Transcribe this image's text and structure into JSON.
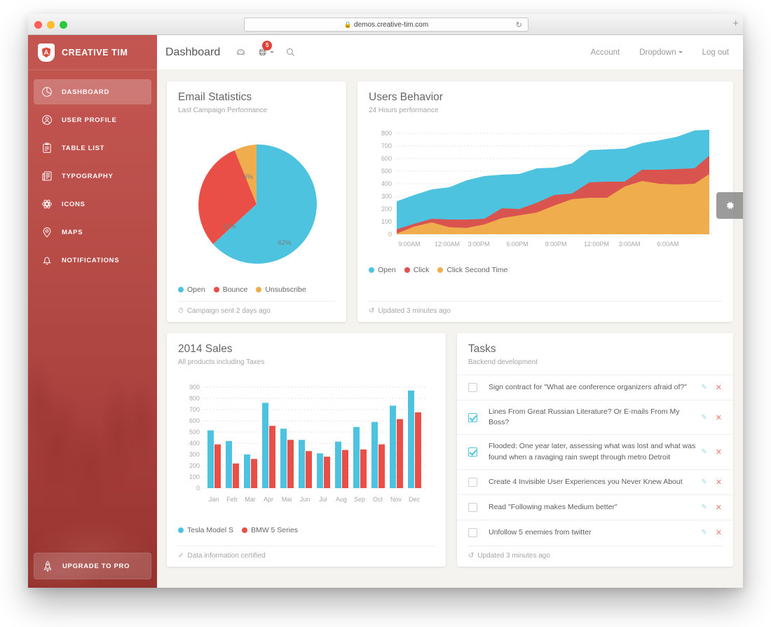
{
  "browser": {
    "url": "demos.creative-tim.com",
    "lock_icon": "lock-icon",
    "reload_icon": "reload-icon",
    "new_tab_label": "+"
  },
  "sidebar": {
    "brand": "CREATIVE TIM",
    "logo_icon": "angular-shield-icon",
    "items": [
      {
        "label": "DASHBOARD",
        "icon": "pie-chart-icon",
        "active": true
      },
      {
        "label": "USER PROFILE",
        "icon": "user-circle-icon",
        "active": false
      },
      {
        "label": "TABLE LIST",
        "icon": "clipboard-icon",
        "active": false
      },
      {
        "label": "TYPOGRAPHY",
        "icon": "document-icon",
        "active": false
      },
      {
        "label": "ICONS",
        "icon": "atom-icon",
        "active": false
      },
      {
        "label": "MAPS",
        "icon": "map-pin-icon",
        "active": false
      },
      {
        "label": "NOTIFICATIONS",
        "icon": "bell-icon",
        "active": false
      }
    ],
    "upgrade": {
      "label": "UPGRADE TO PRO",
      "icon": "rocket-icon"
    }
  },
  "topnav": {
    "title": "Dashboard",
    "dashboard_icon": "dashboard-gauge-icon",
    "globe_icon": "globe-icon",
    "notification_count": "5",
    "search_icon": "search-icon",
    "links": [
      {
        "label": "Account",
        "caret": false
      },
      {
        "label": "Dropdown",
        "caret": true
      },
      {
        "label": "Log out",
        "caret": false
      }
    ]
  },
  "gear_tab": {
    "icon": "gear-icon"
  },
  "cards": {
    "email_statistics": {
      "title": "Email Statistics",
      "subtitle": "Last Campaign Performance",
      "footer": "Campaign sent 2 days ago",
      "footer_icon": "clock-icon"
    },
    "users_behavior": {
      "title": "Users Behavior",
      "subtitle": "24 Hours performance",
      "footer": "Updated 3 minutes ago",
      "footer_icon": "history-icon"
    },
    "sales_2014": {
      "title": "2014 Sales",
      "subtitle": "All products including Taxes",
      "footer": "Data information certified",
      "footer_icon": "check-icon"
    },
    "tasks": {
      "title": "Tasks",
      "subtitle": "Backend development",
      "footer": "Updated 3 minutes ago",
      "footer_icon": "history-icon",
      "edit_icon": "edit-pencil-icon",
      "delete_icon": "close-x-icon",
      "items": [
        {
          "text": "Sign contract for \"What are conference organizers afraid of?\"",
          "checked": false
        },
        {
          "text": "Lines From Great Russian Literature? Or E-mails From My Boss?",
          "checked": true
        },
        {
          "text": "Flooded: One year later, assessing what was lost and what was found when a ravaging rain swept through metro Detroit",
          "checked": true
        },
        {
          "text": "Create 4 Invisible User Experiences you Never Knew About",
          "checked": false
        },
        {
          "text": "Read \"Following makes Medium better\"",
          "checked": false
        },
        {
          "text": "Unfollow 5 enemies from twitter",
          "checked": false
        }
      ]
    }
  },
  "colors": {
    "blue": "#4ec3e0",
    "red": "#ea4f47",
    "orange": "#f0ad4e",
    "brand_red": "#a93f3b",
    "badge_red": "#e0403a"
  },
  "chart_data": [
    {
      "id": "email-statistics-pie",
      "type": "pie",
      "title": "Email Statistics",
      "subtitle": "Last Campaign Performance",
      "labels": [
        "Open",
        "Bounce",
        "Unsubscribe"
      ],
      "values": [
        62,
        32,
        6
      ],
      "value_labels": [
        "62%",
        "32%",
        "6%"
      ],
      "colors": [
        "#4ec3e0",
        "#ea4f47",
        "#f0ad4e"
      ],
      "legend_position": "bottom"
    },
    {
      "id": "users-behavior-area",
      "type": "area",
      "title": "Users Behavior",
      "subtitle": "24 Hours performance",
      "stacked": true,
      "xlabel": "",
      "ylabel": "",
      "ylim": [
        0,
        800
      ],
      "yticks": [
        0,
        100,
        200,
        300,
        400,
        500,
        600,
        700,
        800
      ],
      "grid": true,
      "x": [
        "9:00AM",
        "12:00AM",
        "3:00PM",
        "6:00PM",
        "9:00PM",
        "12:00PM",
        "3:00AM",
        "6:00AM"
      ],
      "xticks": [
        "9:00AM",
        "12:00AM",
        "3:00PM",
        "6:00PM",
        "9:00PM",
        "12:00PM",
        "3:00AM",
        "6:00AM"
      ],
      "legend": [
        "Open",
        "Click",
        "Click Second Time"
      ],
      "legend_position": "bottom",
      "colors": [
        "#4ec3e0",
        "#d9534f",
        "#f0ad4e"
      ],
      "series": [
        {
          "name": "Click Second Time",
          "values": [
            5,
            60,
            95,
            55,
            50,
            80,
            130,
            150,
            170,
            230,
            280,
            290,
            290,
            380,
            420,
            400,
            395,
            400,
            480
          ]
        },
        {
          "name": "Click",
          "values": [
            40,
            85,
            120,
            115,
            115,
            120,
            205,
            200,
            250,
            310,
            325,
            410,
            415,
            415,
            510,
            512,
            515,
            525,
            625
          ]
        },
        {
          "name": "Open",
          "values": [
            260,
            310,
            355,
            370,
            430,
            460,
            470,
            480,
            520,
            530,
            560,
            665,
            670,
            680,
            720,
            745,
            775,
            820,
            830
          ]
        }
      ]
    },
    {
      "id": "sales-2014-bar",
      "type": "bar",
      "title": "2014 Sales",
      "subtitle": "All products including Taxes",
      "categories": [
        "Jan",
        "Feb",
        "Mar",
        "Apr",
        "Mai",
        "Jun",
        "Jul",
        "Aug",
        "Sep",
        "Oct",
        "Nov",
        "Dec"
      ],
      "ylim": [
        0,
        900
      ],
      "yticks": [
        0,
        100,
        200,
        300,
        400,
        500,
        600,
        700,
        800,
        900
      ],
      "grid": true,
      "legend_position": "bottom",
      "colors": [
        "#4ec3e0",
        "#ea4f47"
      ],
      "series": [
        {
          "name": "Tesla Model S",
          "values": [
            515,
            420,
            300,
            760,
            530,
            430,
            310,
            415,
            545,
            590,
            735,
            870
          ]
        },
        {
          "name": "BMW 5 Series",
          "values": [
            390,
            220,
            260,
            555,
            430,
            330,
            280,
            340,
            345,
            390,
            615,
            675
          ]
        }
      ]
    }
  ]
}
